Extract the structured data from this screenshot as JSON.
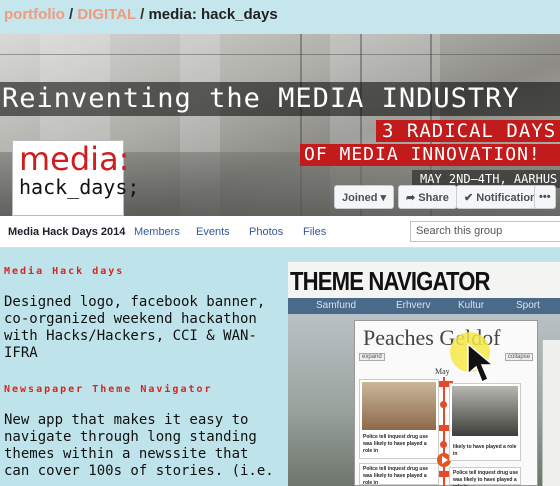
{
  "breadcrumb": {
    "part1": "portfolio",
    "sep1": " / ",
    "part2": "DIGITAL",
    "sep2": " / ",
    "part3": "media: hack_days"
  },
  "banner": {
    "headline": "Reinventing the MEDIA INDUSTRY",
    "line2": "3 RADICAL DAYS",
    "line3": "OF MEDIA INNOVATION!",
    "date": "MAY 2ND–4TH, AARHUS",
    "logo_line1": "media:",
    "logo_line2": "hack_days;"
  },
  "fb": {
    "joined": "Joined ▾",
    "share": "➦ Share",
    "notifications": "✔ Notifications",
    "more": "•••",
    "group_title": "Media Hack Days 2014",
    "tabs": [
      "Members",
      "Events",
      "Photos",
      "Files"
    ],
    "search_placeholder": "Search this group"
  },
  "text": {
    "h1": "Media Hack days",
    "p1": "Designed logo, facebook banner, co-organized weekend hackathon with Hacks/Hackers, CCI & WAN-IFRA",
    "h2": "Newsapaper Theme Navigator",
    "p2": "New app that makes it easy to navigate through long standing themes within a newssite that can cover 100s of stories. (i.e."
  },
  "navigator": {
    "title": "THEME NAVIGATOR",
    "nav": [
      "Samfund",
      "Erhverv",
      "Kultur",
      "Sport"
    ],
    "heading": "Peaches Geldof",
    "expand": "expand",
    "collapse": "collapse",
    "month": "May",
    "caption": "Police tell inquest drug use was likely to have played a role in",
    "caption_short": "likely to have played a role in"
  },
  "colors": {
    "accent_red": "#d8251c",
    "fb_link": "#365899",
    "page_bg": "#bfe3ea"
  }
}
